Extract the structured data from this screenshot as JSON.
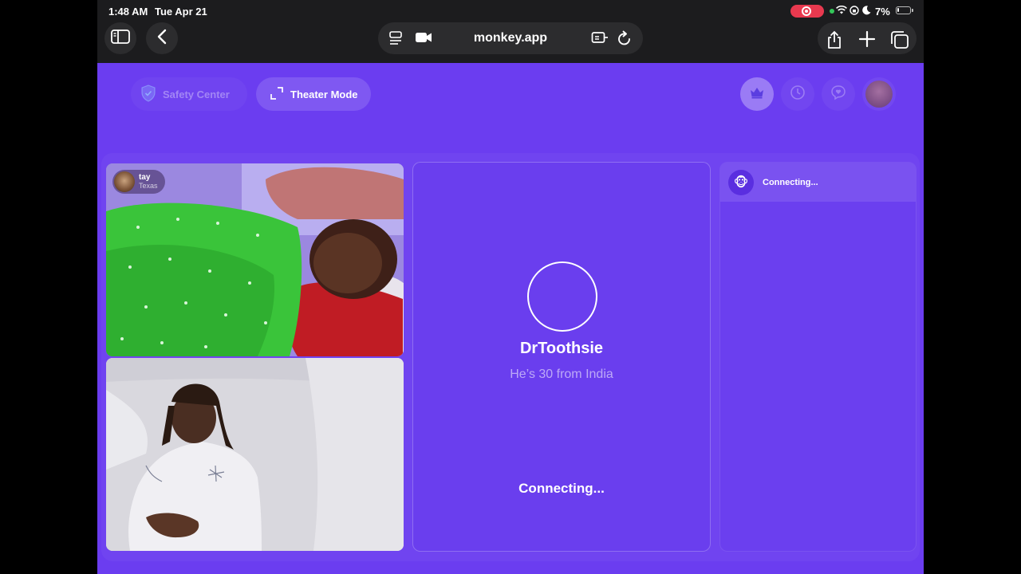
{
  "status_bar": {
    "time": "1:48 AM",
    "date": "Tue Apr 21",
    "battery": "7%"
  },
  "browser": {
    "url": "monkey.app"
  },
  "header": {
    "safety_center": "Safety Center",
    "theater_mode": "Theater Mode"
  },
  "remote_user": {
    "name": "tay",
    "location": "Texas"
  },
  "match": {
    "name": "DrToothsie",
    "subtitle": "He’s 30 from India",
    "status": "Connecting..."
  },
  "chat": {
    "status": "Connecting..."
  },
  "colors": {
    "page_bg": "#6b3df0",
    "accent_record": "#e8394f"
  },
  "icons": {
    "status_bar": [
      "record-icon",
      "wifi-icon",
      "orientation-lock-icon",
      "moon-icon",
      "battery-icon"
    ],
    "toolbar": [
      "sidebar-icon",
      "back-icon",
      "tabs-overview-icon",
      "video-icon",
      "reader-icon",
      "reload-icon",
      "share-icon",
      "plus-icon",
      "tabs-icon"
    ],
    "header": [
      "shield-icon",
      "expand-icon",
      "crown-icon",
      "clock-icon",
      "heart-chat-icon"
    ],
    "chat": [
      "monkey-icon"
    ]
  }
}
